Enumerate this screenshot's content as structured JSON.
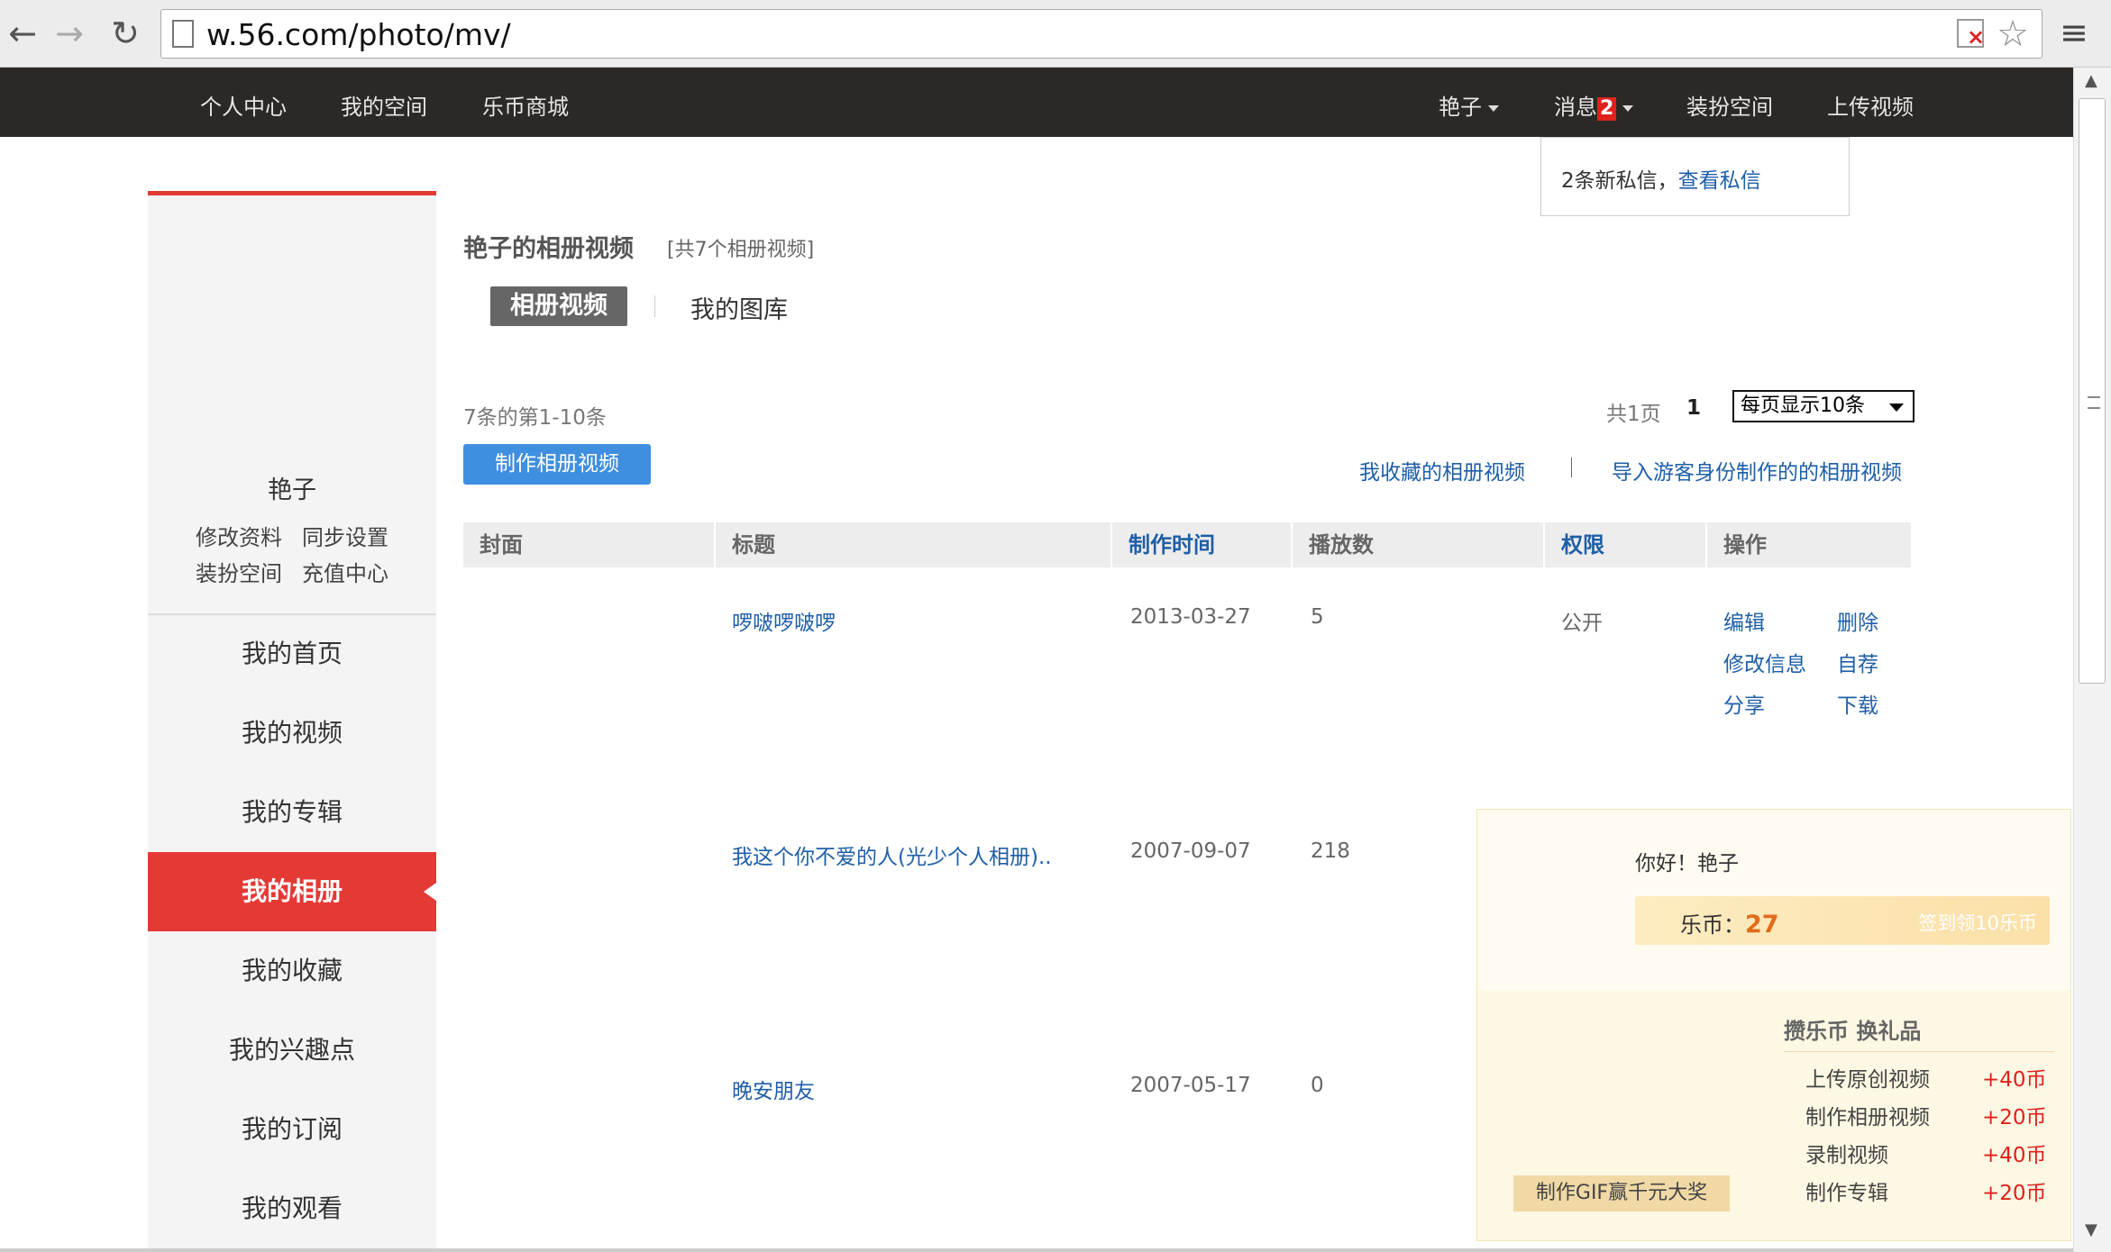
{
  "browser": {
    "url": "w.56.com/photo/mv/"
  },
  "topnav": {
    "left": [
      "个人中心",
      "我的空间",
      "乐币商城"
    ],
    "user": "艳子",
    "messages_label": "消息",
    "messages_count": "2",
    "dress": "装扮空间",
    "upload": "上传视频"
  },
  "msg_dropdown": {
    "text": "2条新私信，",
    "link": "查看私信"
  },
  "sidebar": {
    "username": "艳子",
    "links": [
      "修改资料",
      "同步设置",
      "装扮空间",
      "充值中心"
    ],
    "items": [
      "我的首页",
      "我的视频",
      "我的专辑",
      "我的相册",
      "我的收藏",
      "我的兴趣点",
      "我的订阅",
      "我的观看"
    ],
    "active": "我的相册"
  },
  "content": {
    "title": "艳子的相册视频",
    "count_text": "[共7个相册视频]",
    "tabs": [
      "相册视频",
      "我的图库"
    ],
    "range": "7条的第1-10条",
    "pages_total": "共1页",
    "page": "1",
    "per_page": "每页显示10条",
    "make_button": "制作相册视频",
    "link_fav": "我收藏的相册视频",
    "link_import": "导入游客身份制作的的相册视频"
  },
  "table": {
    "headers": [
      "封面",
      "标题",
      "制作时间",
      "播放数",
      "权限",
      "操作"
    ],
    "rows": [
      {
        "title": "啰啵啰啵啰",
        "date": "2013-03-27",
        "plays": "5",
        "perm": "公开",
        "ops": [
          "编辑",
          "删除",
          "修改信息",
          "自荐",
          "分享",
          "下载"
        ]
      },
      {
        "title": "我这个你不爱的人(光少个人相册)..",
        "date": "2007-09-07",
        "plays": "218"
      },
      {
        "title": "晚安朋友",
        "date": "2007-05-17",
        "plays": "0"
      }
    ]
  },
  "promo": {
    "greeting": "你好！艳子",
    "coins_label": "乐币：",
    "coins": "27",
    "signin": "签到领10乐币",
    "earn_title": "攒乐币 换礼品",
    "earn": [
      {
        "name": "上传原创视频",
        "value": "+40币"
      },
      {
        "name": "制作相册视频",
        "value": "+20币"
      },
      {
        "name": "录制视频",
        "value": "+40币"
      },
      {
        "name": "制作专辑",
        "value": "+20币"
      }
    ],
    "gif_button": "制作GIF赢千元大奖"
  },
  "colors": {
    "accent_red": "#e53935",
    "link_blue": "#1f5fa8",
    "button_blue": "#3f8fe0",
    "nav_bg": "#2b2826"
  }
}
